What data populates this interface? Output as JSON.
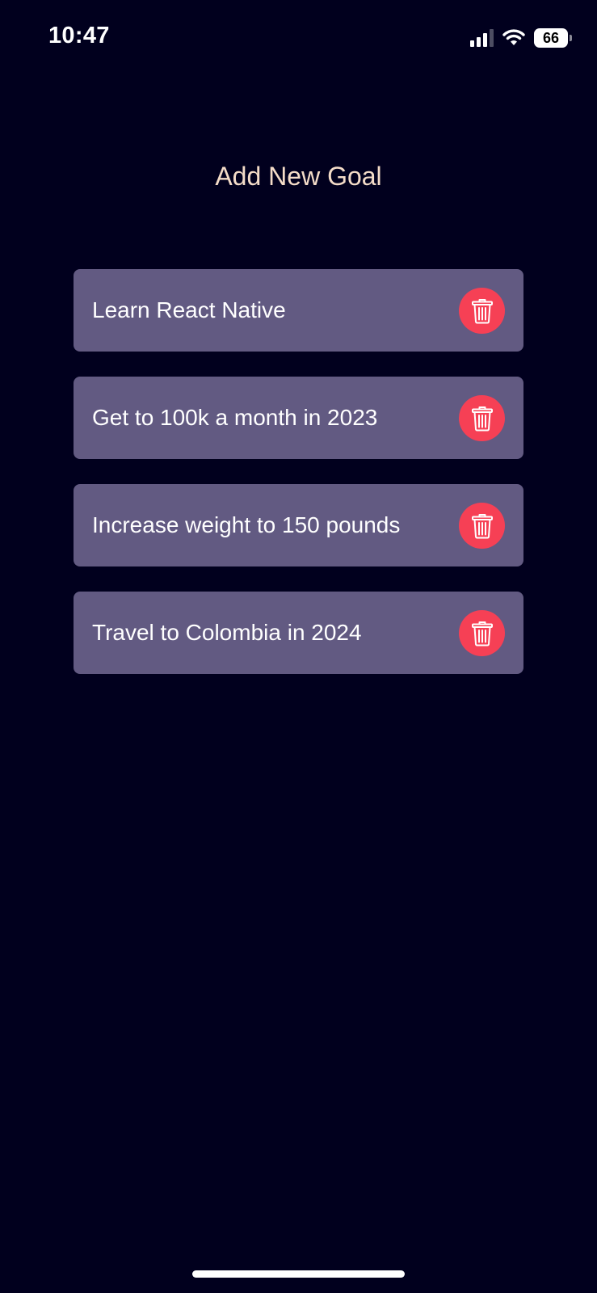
{
  "status_bar": {
    "time": "10:47",
    "battery_level": "66",
    "icons": [
      "signal-icon",
      "wifi-icon",
      "battery-icon"
    ]
  },
  "header": {
    "title": "Add New Goal"
  },
  "goals": [
    {
      "text": "Learn React Native",
      "delete_icon": "trash-icon"
    },
    {
      "text": "Get to 100k a month in 2023",
      "delete_icon": "trash-icon"
    },
    {
      "text": "Increase weight to 150 pounds",
      "delete_icon": "trash-icon"
    },
    {
      "text": "Travel to Colombia in 2024",
      "delete_icon": "trash-icon"
    }
  ],
  "colors": {
    "background": "#01001e",
    "title_text": "#f4dcc8",
    "goal_card": "#625a82",
    "goal_text": "#ffffff",
    "delete_button": "#f64055"
  }
}
